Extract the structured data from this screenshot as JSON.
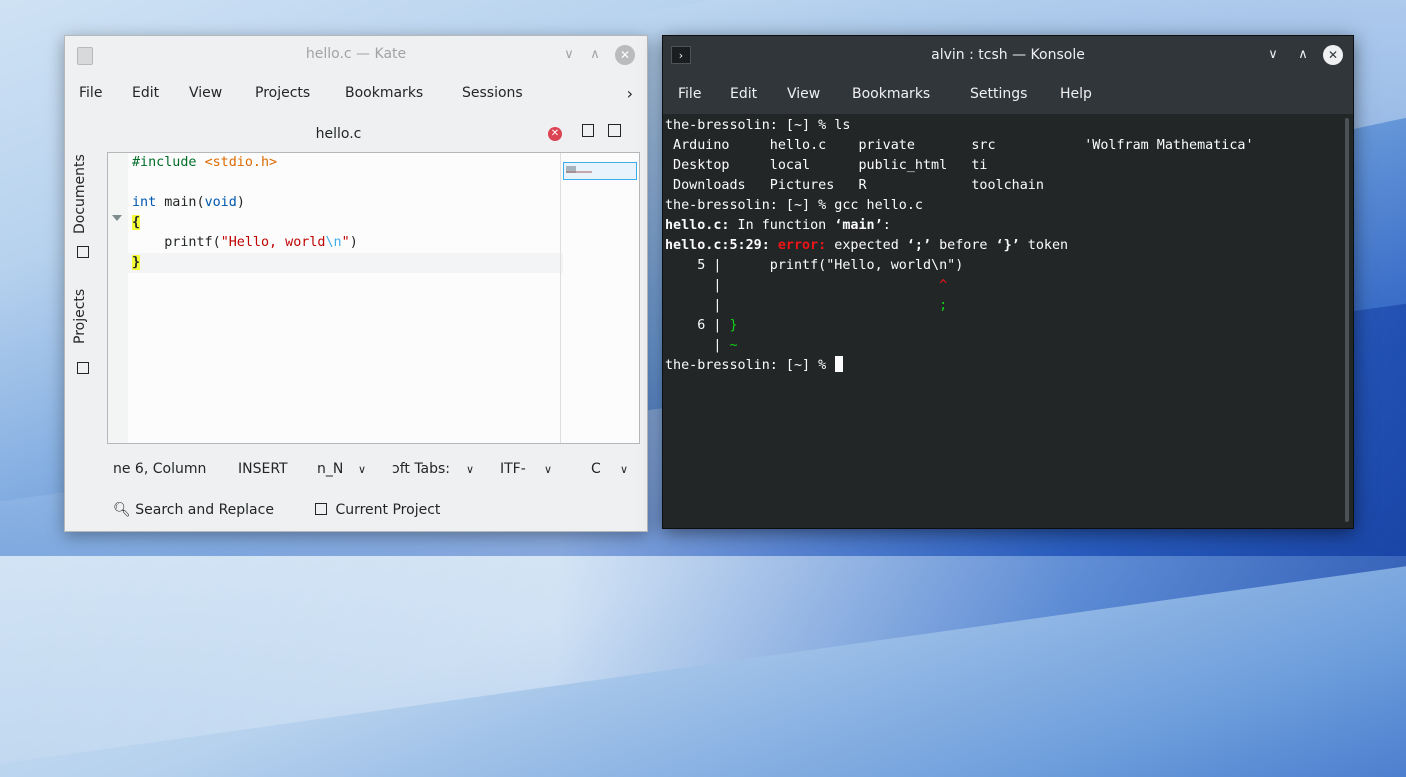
{
  "kate": {
    "title": "hello.c — Kate",
    "window_min": "∨",
    "window_max": "∧",
    "window_close": "✕",
    "menu": [
      "File",
      "Edit",
      "View",
      "Projects",
      "Bookmarks",
      "Sessions"
    ],
    "menu_more": "›",
    "sidebar": {
      "documents": "Documents",
      "projects": "Projects"
    },
    "tab": {
      "label": "hello.c",
      "close": "✕"
    },
    "code": {
      "line1_pre": "#include ",
      "line1_inc": "<stdio.h>",
      "line3_kw": "int",
      "line3_mid": " main(",
      "line3_kw2": "void",
      "line3_end": ")",
      "line4": "{",
      "line5_indent": "    printf(",
      "line5_str": "\"Hello, world",
      "line5_esc": "\\n",
      "line5_str_end": "\"",
      "line5_end": ")",
      "line6": "}"
    },
    "status": {
      "position": "ne 6, Column",
      "mode": "INSERT",
      "line_ending": "n_N",
      "indent": "ɔft Tabs:",
      "encoding": "ITF-",
      "language": "C",
      "dropdown": "∨"
    },
    "toolviews": {
      "search": "Search and Replace",
      "project": "Current Project"
    }
  },
  "konsole": {
    "title": "alvin : tcsh — Konsole",
    "icon": "›",
    "window_min": "∨",
    "window_max": "∧",
    "window_close": "✕",
    "menu": [
      "File",
      "Edit",
      "View",
      "Bookmarks",
      "Settings",
      "Help"
    ],
    "lines": {
      "l1": "the-bressolin: [~] % ls",
      "l2": " Arduino     hello.c    private       src           'Wolfram Mathematica'",
      "l3": " Desktop     local      public_html   ti",
      "l4": " Downloads   Pictures   R             toolchain",
      "l5": "the-bressolin: [~] % gcc hello.c",
      "l6_file": "hello.c:",
      "l6_text": " In function ",
      "l6_fn": "‘main’",
      "l6_end": ":",
      "l7_loc": "hello.c:5:29:",
      "l7_err": " error:",
      "l7_a": " expected ",
      "l7_semi": "‘;’",
      "l7_b": " before ",
      "l7_brace": "‘}’",
      "l7_c": " token",
      "l8": "    5 |      printf(\"Hello, world\\n\")",
      "l9_bar": "      |",
      "l9_mark": "                           ^",
      "l10_bar": "      |",
      "l10_mark": "                           ;",
      "l11_num": "    6 |",
      "l11_brace": " }",
      "l12_bar": "      |",
      "l12_mark": " ~",
      "l13": "the-bressolin: [~] % "
    }
  }
}
